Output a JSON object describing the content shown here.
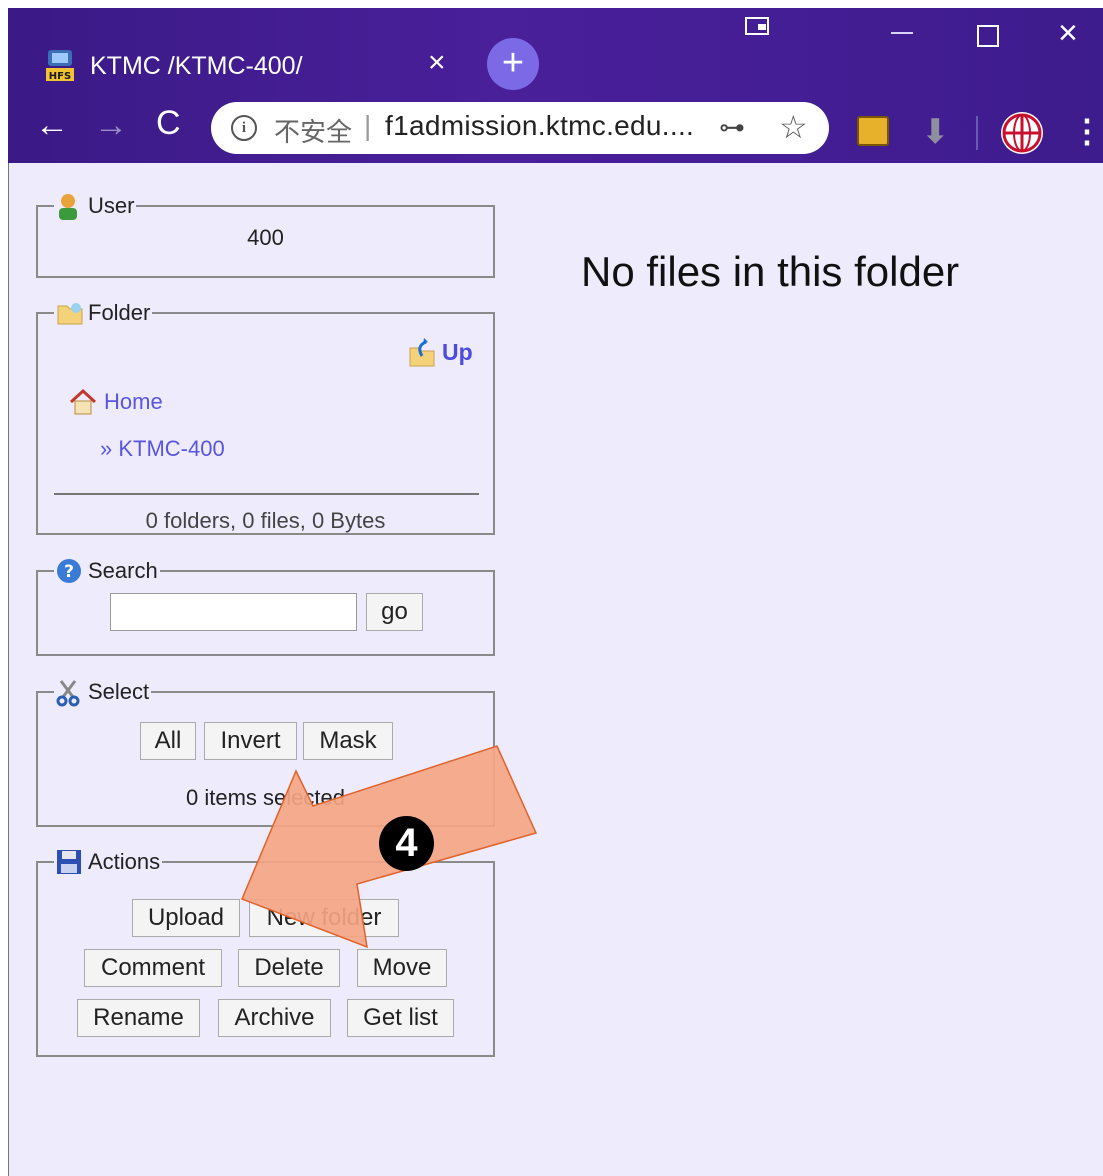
{
  "browser": {
    "tab_title": "KTMC /KTMC-400/",
    "insecure_label": "不安全",
    "url_separator": "|",
    "url": "f1admission.ktmc.edu....",
    "close_tab": "×",
    "new_tab": "+",
    "back": "←",
    "forward": "→",
    "reload": "C",
    "window_close": "×",
    "menu": "⋮"
  },
  "user_panel": {
    "legend": "User",
    "value": "400"
  },
  "folder_panel": {
    "legend": "Folder",
    "up_label": "Up",
    "breadcrumb": {
      "home": "Home",
      "current": "» KTMC-400"
    },
    "summary": "0 folders, 0 files, 0 Bytes"
  },
  "search_panel": {
    "legend": "Search",
    "input_value": "",
    "go_label": "go"
  },
  "select_panel": {
    "legend": "Select",
    "buttons": [
      "All",
      "Invert",
      "Mask"
    ],
    "status": "0 items selected"
  },
  "actions_panel": {
    "legend": "Actions",
    "row1": [
      "Upload",
      "New folder"
    ],
    "row2": [
      "Comment",
      "Delete",
      "Move"
    ],
    "row3": [
      "Rename",
      "Archive",
      "Get list"
    ]
  },
  "main": {
    "message": "No files in this folder"
  },
  "annotation": {
    "step": "4",
    "arrow_color": "#f4a584"
  },
  "colors": {
    "titlebar": "#3f1c8f",
    "page_bg": "#eeecfc",
    "link": "#5a55e0"
  }
}
